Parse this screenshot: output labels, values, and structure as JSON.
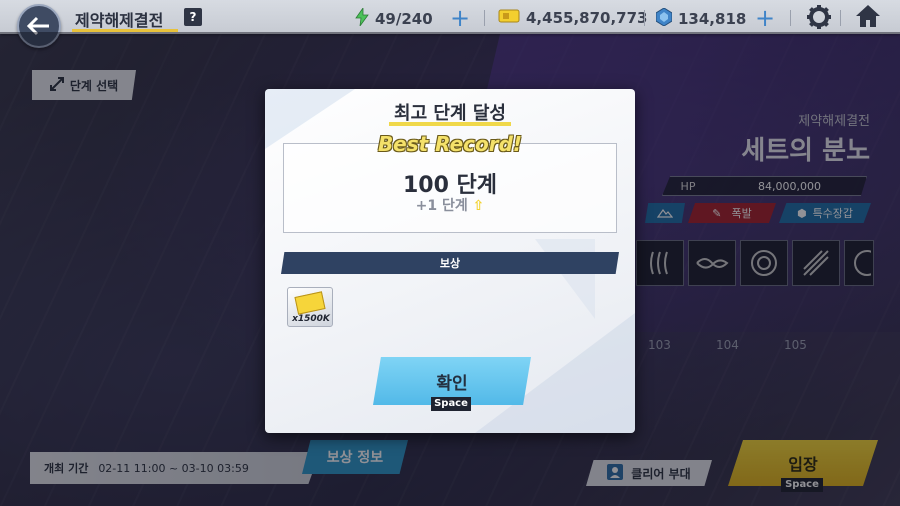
{
  "header": {
    "title": "제약해제결전",
    "help": "?",
    "stamina": "49/240",
    "gold": "4,455,870,773",
    "gems": "134,818"
  },
  "left": {
    "stage_select": "단계 선택",
    "period_label": "개최 기간",
    "period_value": "02-11 11:00 ~ 03-10 03:59",
    "reward_info": "보상 정보"
  },
  "boss": {
    "subtitle": "제약해제결전",
    "name": "세트의 분노",
    "hp_label": "HP",
    "hp_value": "84,000,000",
    "tags": [
      "폭발",
      "특수장갑"
    ],
    "stage_numbers": [
      "103",
      "104",
      "105"
    ]
  },
  "bottom": {
    "clear_party": "클리어 부대",
    "enter": "입장",
    "enter_key": "Space"
  },
  "modal": {
    "title": "최고 단계 달성",
    "best_record": "Best Record!",
    "stage": "100 단계",
    "delta": "+1 단계",
    "reward_header": "보상",
    "reward_qty": "x1500K",
    "confirm": "확인",
    "confirm_key": "Space"
  },
  "colors": {
    "accent_yellow": "#f0d84a",
    "confirm_blue": "#52b9e8",
    "reward_header_navy": "#2f4262",
    "enter_yellow": "#f6d83a",
    "tag_red": "#a6222c",
    "tag_blue": "#1f6fa8"
  },
  "icons": [
    "back-arrow-icon",
    "help-icon",
    "lightning-icon",
    "ticket-icon",
    "gem-icon",
    "gear-icon",
    "home-icon"
  ]
}
